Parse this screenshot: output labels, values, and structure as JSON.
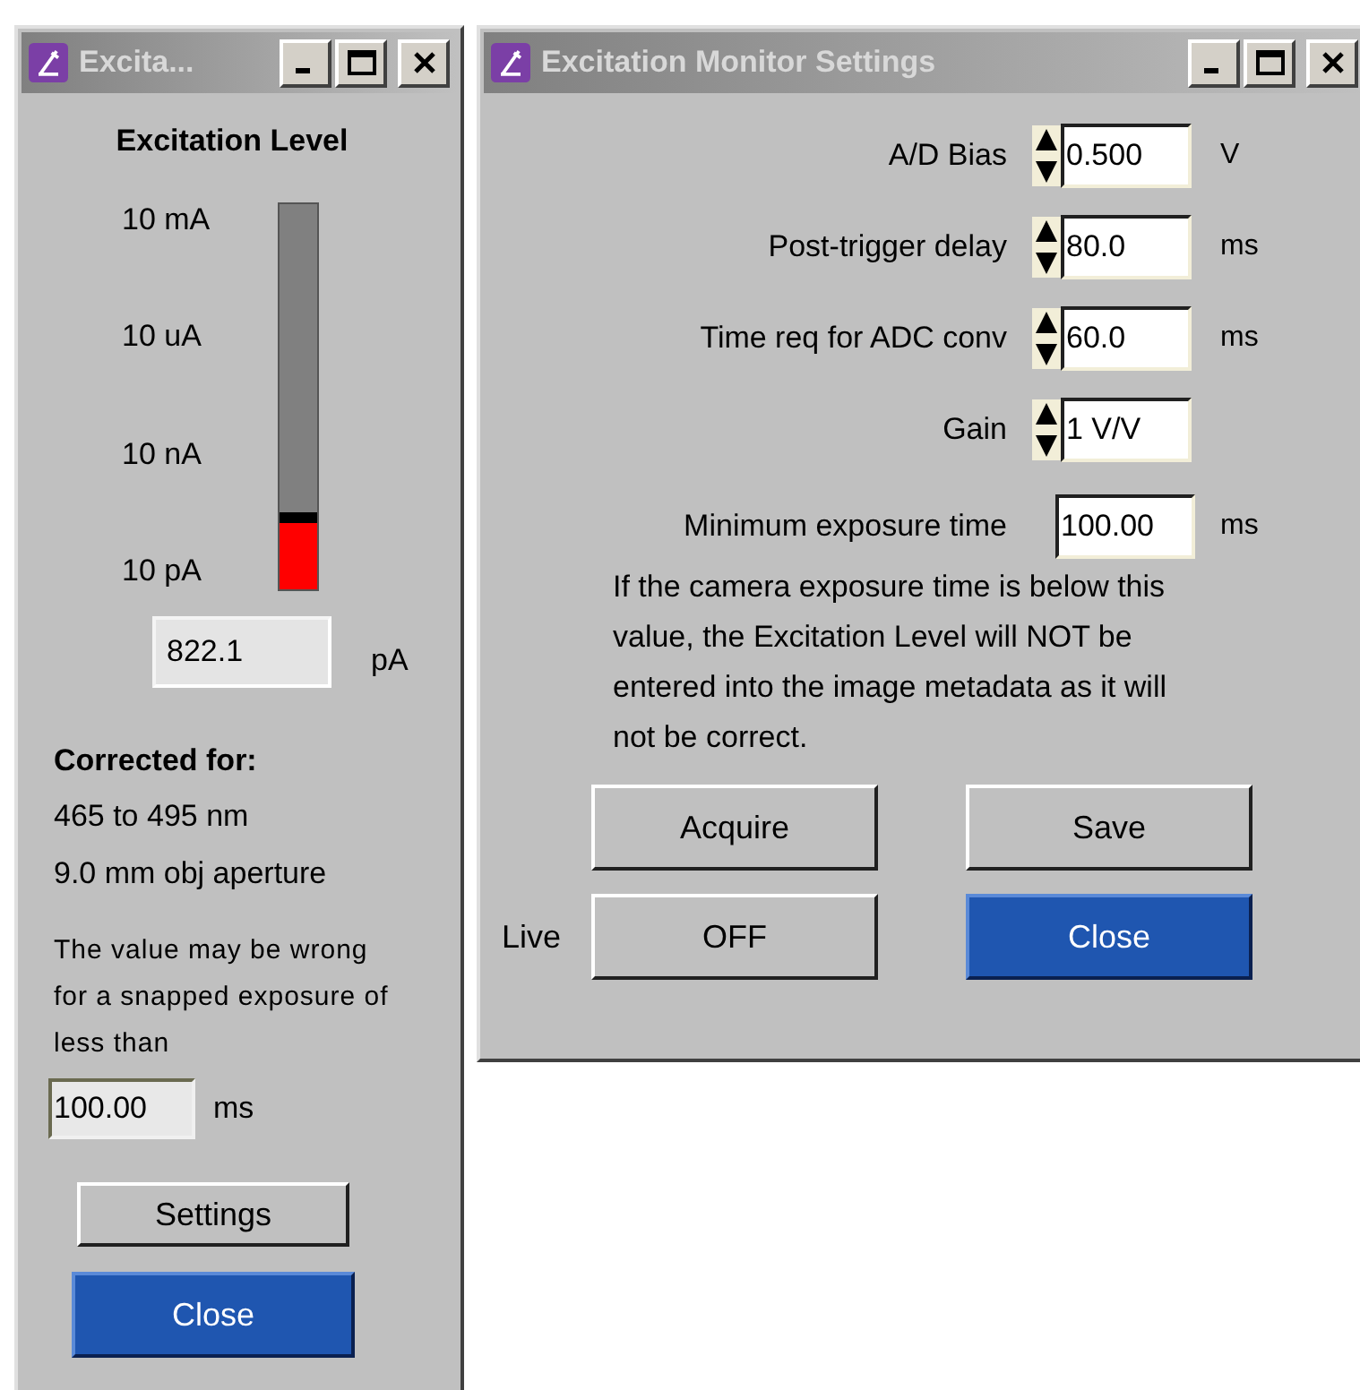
{
  "meter_window": {
    "title": "Excita...",
    "heading": "Excitation Level",
    "scale_labels": [
      "10 mA",
      "10 uA",
      "10 nA",
      "10 pA"
    ],
    "meter": {
      "level": 0.2
    },
    "reading": {
      "value": "822.1",
      "unit": "pA"
    },
    "corrected_heading": "Corrected for:",
    "corrected_lines": [
      "465 to 495 nm",
      "9.0 mm obj aperture"
    ],
    "warning": "The value may be wrong for a snapped exposure of less than",
    "min_exposure": {
      "value": "100.00",
      "unit": "ms"
    },
    "buttons": [
      {
        "label": "Settings",
        "default": false
      },
      {
        "label": "Close",
        "default": true
      }
    ]
  },
  "settings_window": {
    "title": "Excitation Monitor Settings",
    "fields": [
      {
        "label": "A/D Bias",
        "value": "0.500",
        "unit": "V",
        "kind": "spinner"
      },
      {
        "label": "Post-trigger delay",
        "value": "80.0",
        "unit": "ms",
        "kind": "spinner"
      },
      {
        "label": "Time req for ADC conv",
        "value": "60.0",
        "unit": "ms",
        "kind": "spinner"
      },
      {
        "label": "Gain",
        "value": "1 V/V",
        "kind": "spinner"
      },
      {
        "label": "Minimum exposure time",
        "value": "100.00",
        "unit": "ms",
        "kind": "plain"
      }
    ],
    "note": "If the camera exposure time is below this value, the Excitation Level will NOT be entered into the image metadata as it will not be correct.",
    "live_label": "Live",
    "buttons": [
      {
        "label": "Acquire",
        "default": false
      },
      {
        "label": "Save",
        "default": false
      },
      {
        "label": "OFF",
        "default": false
      },
      {
        "label": "Close",
        "default": true
      }
    ]
  }
}
